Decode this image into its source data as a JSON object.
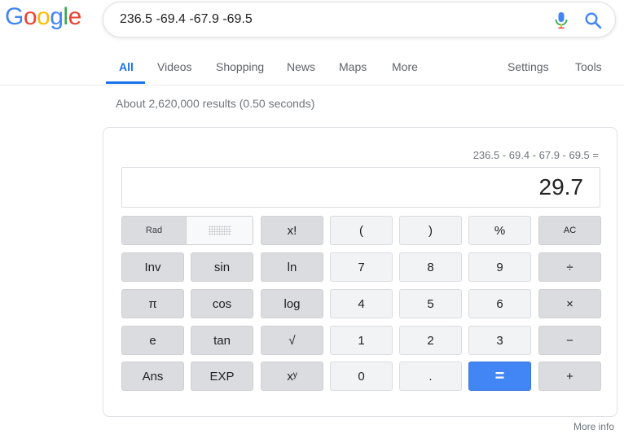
{
  "logo": {
    "letters": [
      "G",
      "o",
      "o",
      "g",
      "l",
      "e"
    ],
    "colors": [
      "#4285f4",
      "#ea4335",
      "#fbbc05",
      "#4285f4",
      "#34a853",
      "#ea4335"
    ]
  },
  "search": {
    "value": "236.5 -69.4 -67.9 -69.5"
  },
  "tabs": {
    "all": "All",
    "videos": "Videos",
    "shopping": "Shopping",
    "news": "News",
    "maps": "Maps",
    "more": "More",
    "settings": "Settings",
    "tools": "Tools"
  },
  "stats": "About 2,620,000 results (0.50 seconds)",
  "calculator": {
    "expression": "236.5 - 69.4 - 67.9 - 69.5 =",
    "result": "29.7",
    "rad_label": "Rad",
    "keys": {
      "fact": "x!",
      "lparen": "(",
      "rparen": ")",
      "percent": "%",
      "ac": "AC",
      "inv": "Inv",
      "sin": "sin",
      "ln": "ln",
      "seven": "7",
      "eight": "8",
      "nine": "9",
      "divide": "÷",
      "pi": "π",
      "cos": "cos",
      "log": "log",
      "four": "4",
      "five": "5",
      "six": "6",
      "multiply": "×",
      "e": "e",
      "tan": "tan",
      "sqrt": "√",
      "one": "1",
      "two": "2",
      "three": "3",
      "minus": "−",
      "ans": "Ans",
      "exp": "EXP",
      "power": "xʸ",
      "zero": "0",
      "dot": ".",
      "equals": "=",
      "plus": "+"
    }
  },
  "more_info": "More info",
  "colors": {
    "accent": "#1a73e8",
    "equals_key": "#4285f4"
  }
}
